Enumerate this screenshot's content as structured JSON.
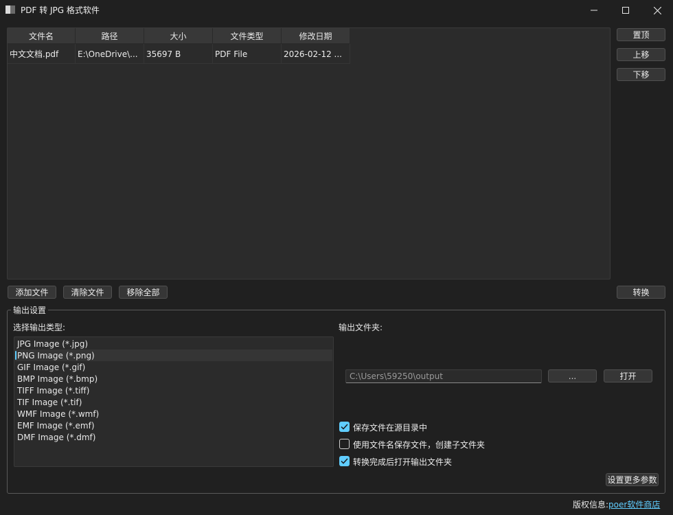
{
  "window": {
    "title": "PDF 转 JPG 格式软件"
  },
  "table": {
    "columns": [
      "文件名",
      "路径",
      "大小",
      "文件类型",
      "修改日期"
    ],
    "rows": [
      [
        "中文文档.pdf",
        "E:\\OneDrive\\...",
        "35697 B",
        "PDF File",
        "2026-02-12 ..."
      ]
    ]
  },
  "side_buttons": {
    "top": "置顶",
    "up": "上移",
    "down": "下移",
    "convert": "转换"
  },
  "file_buttons": {
    "add": "添加文件",
    "clear": "清除文件",
    "remove_all": "移除全部"
  },
  "output_settings": {
    "group_title": "输出设置",
    "type_label": "选择输出类型:",
    "formats": [
      "JPG Image (*.jpg)",
      "PNG Image (*.png)",
      "GIF Image (*.gif)",
      "BMP Image (*.bmp)",
      "TIFF Image (*.tiff)",
      "TIF Image (*.tif)",
      "WMF Image (*.wmf)",
      "EMF Image (*.emf)",
      "DMF Image (*.dmf)"
    ],
    "selected_format": "PNG Image (*.png)",
    "folder_label": "输出文件夹:",
    "output_path": "C:\\Users\\59250\\output",
    "browse_label": "...",
    "open_label": "打开",
    "options": [
      {
        "label": "保存文件在源目录中",
        "checked": true
      },
      {
        "label": "使用文件名保存文件，创建子文件夹",
        "checked": false
      },
      {
        "label": "转换完成后打开输出文件夹",
        "checked": true
      }
    ],
    "more_params_label": "设置更多参数"
  },
  "footer": {
    "copyright_label": "版权信息:",
    "shop_link": "poer软件商店"
  },
  "colors": {
    "background": "#202020",
    "panel": "#2b2b2b",
    "accent": "#60cdff",
    "header": "#383838"
  }
}
